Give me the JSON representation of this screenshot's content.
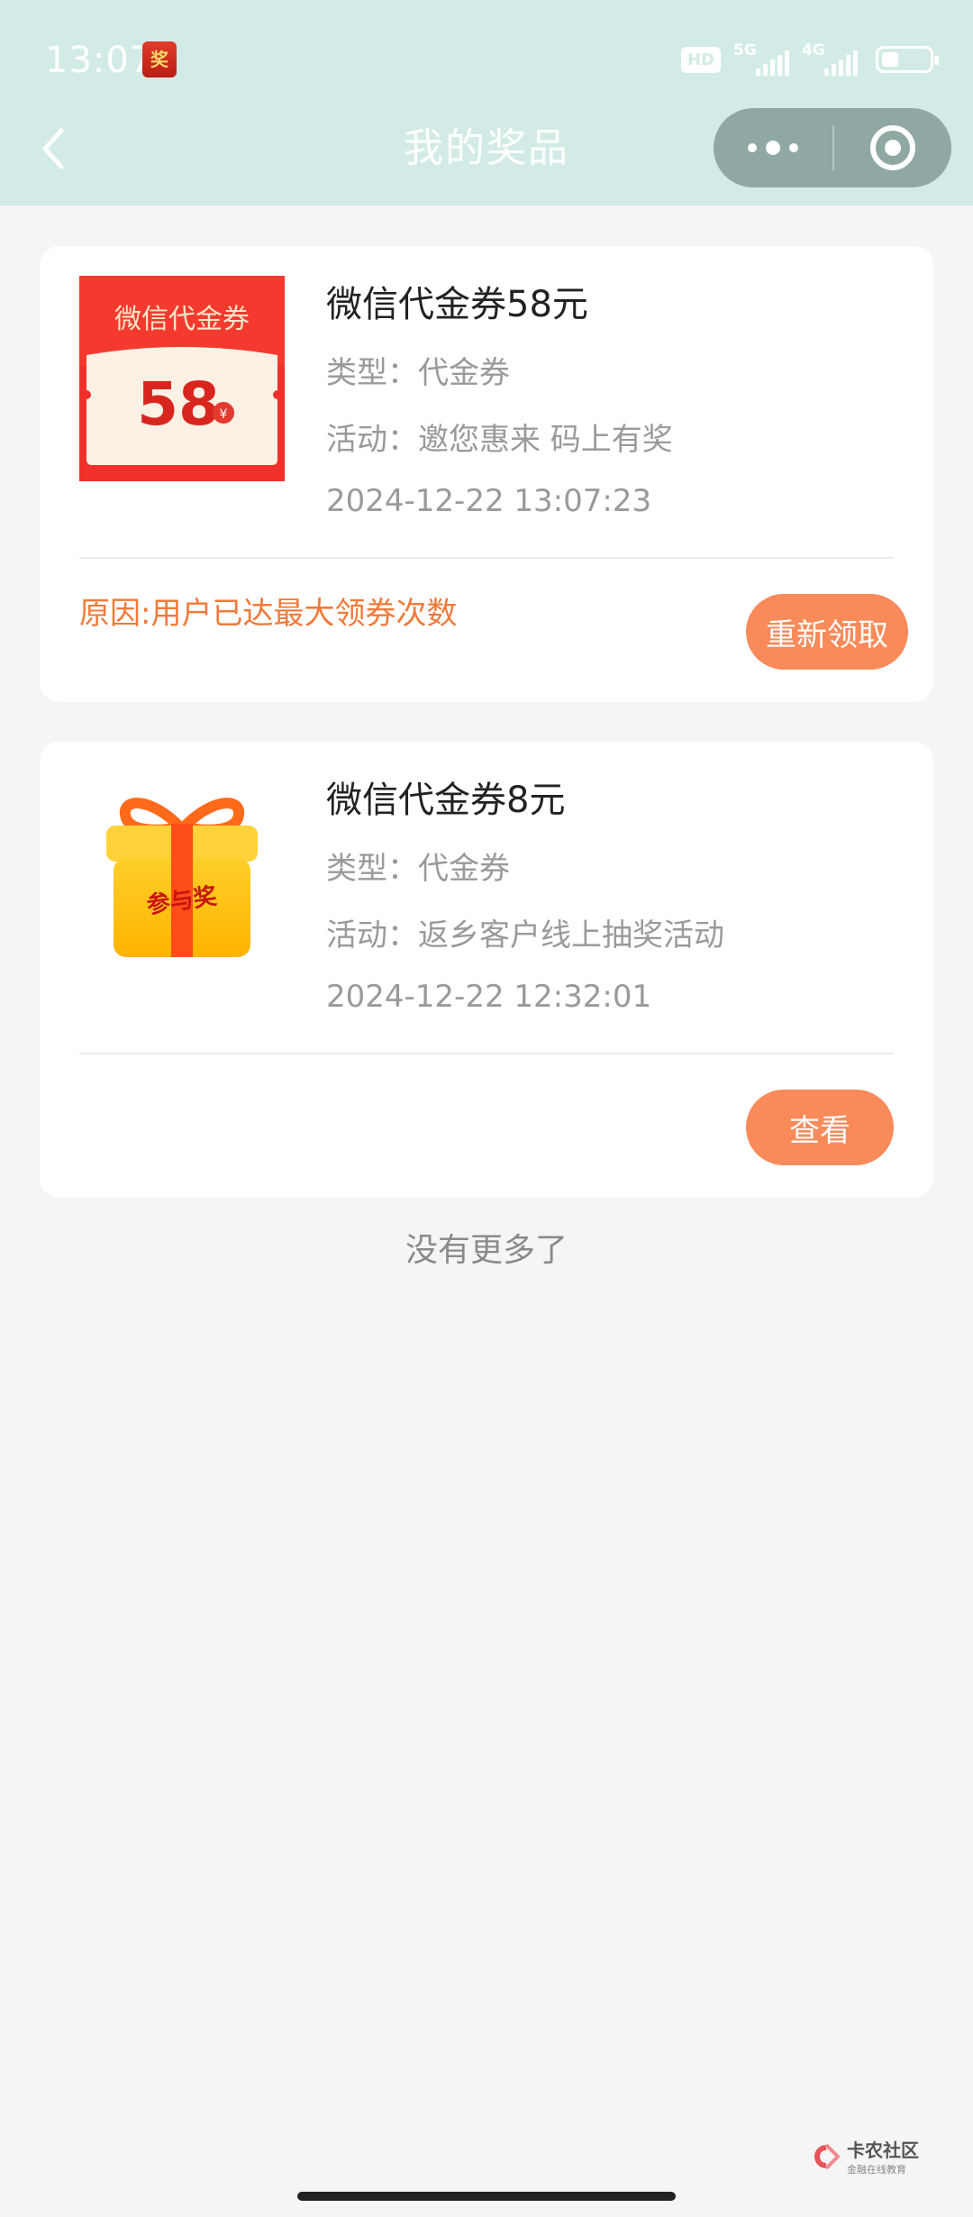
{
  "status_bar": {
    "time": "13:07",
    "app_icon_text": "奖",
    "hd_label": "HD",
    "network_1": "5G",
    "network_2": "4G"
  },
  "nav": {
    "title": "我的奖品",
    "back_icon": "chevron-left-icon",
    "more_icon": "more-dots-icon",
    "close_icon": "target-circle-icon"
  },
  "prizes": [
    {
      "title": "微信代金券58元",
      "type_line": "类型：代金券",
      "activity_line": "活动：邀您惠来 码上有奖",
      "date": "2024-12-22 13:07:23",
      "reason": "原因:用户已达最大领券次数",
      "button": "重新领取",
      "thumb": {
        "header": "微信代金券",
        "amount": "58",
        "currency": "¥"
      }
    },
    {
      "title": "微信代金券8元",
      "type_line": "类型：代金券",
      "activity_line": "活动：返乡客户线上抽奖活动",
      "date": "2024-12-22 12:32:01",
      "reason": "",
      "button": "查看",
      "thumb": {
        "label": "参与奖"
      }
    }
  ],
  "footer": {
    "no_more": "没有更多了"
  },
  "watermark": {
    "name": "卡农社区",
    "sub": "金融在线教育"
  },
  "colors": {
    "topbar": "#d3ebe6",
    "accent": "#f98a5a",
    "reason": "#f07a3a",
    "background": "#f5f5f5"
  }
}
